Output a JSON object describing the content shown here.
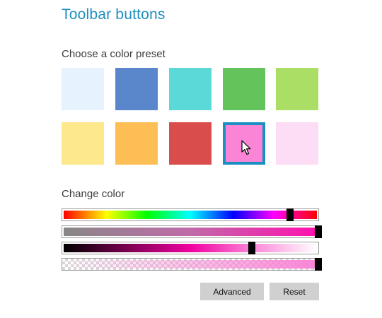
{
  "page": {
    "title": "Toolbar buttons",
    "preset_label": "Choose a color preset",
    "change_label": "Change color"
  },
  "presets": [
    {
      "name": "light-blue",
      "color": "#e6f2fe"
    },
    {
      "name": "blue",
      "color": "#5a87cb"
    },
    {
      "name": "teal",
      "color": "#5bd8d8"
    },
    {
      "name": "green",
      "color": "#64c35a"
    },
    {
      "name": "lime",
      "color": "#aade64"
    },
    {
      "name": "yellow",
      "color": "#fde98b"
    },
    {
      "name": "orange",
      "color": "#fdbe55"
    },
    {
      "name": "red",
      "color": "#da4d4d"
    },
    {
      "name": "pink",
      "color": "#fa84d6",
      "selected": true
    },
    {
      "name": "light-pink",
      "color": "#fddcf5"
    }
  ],
  "sliders": {
    "hue": 0.89,
    "saturation": 1.0,
    "lightness": 0.74,
    "alpha": 1.0
  },
  "colors": {
    "accent": "#1b90c0",
    "selected_color": "#fa84d6"
  },
  "buttons": {
    "advanced": "Advanced",
    "reset": "Reset"
  }
}
